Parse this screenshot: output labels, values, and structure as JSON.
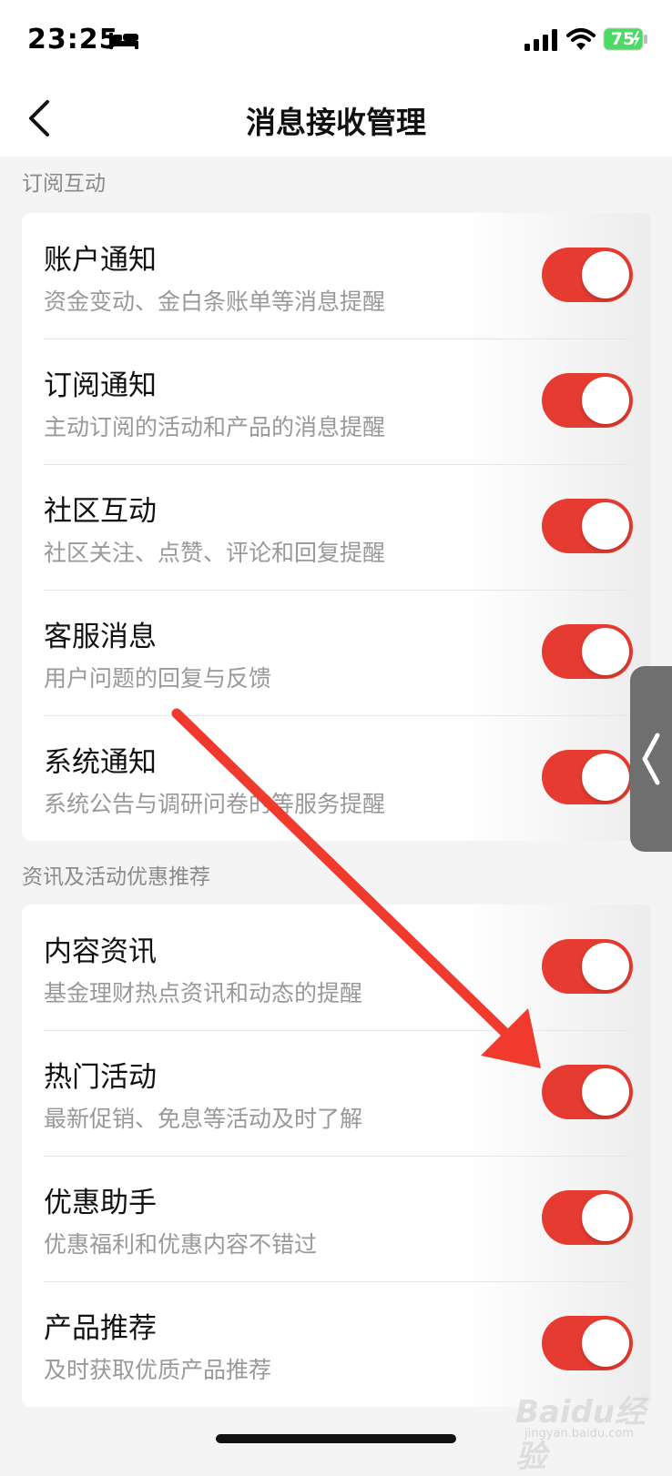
{
  "status_bar": {
    "time": "23:25",
    "battery_level": "75",
    "icons": [
      "bed-icon",
      "signal-icon",
      "wifi-icon",
      "battery-charging-icon"
    ]
  },
  "header": {
    "title": "消息接收管理",
    "back_icon": "chevron-left-icon"
  },
  "sections": [
    {
      "title": "订阅互动",
      "items": [
        {
          "title": "账户通知",
          "subtitle": "资金变动、金白条账单等消息提醒",
          "enabled": true
        },
        {
          "title": "订阅通知",
          "subtitle": "主动订阅的活动和产品的消息提醒",
          "enabled": true
        },
        {
          "title": "社区互动",
          "subtitle": "社区关注、点赞、评论和回复提醒",
          "enabled": true
        },
        {
          "title": "客服消息",
          "subtitle": "用户问题的回复与反馈",
          "enabled": true
        },
        {
          "title": "系统通知",
          "subtitle": "系统公告与调研问卷的等服务提醒",
          "enabled": true
        }
      ]
    },
    {
      "title": "资讯及活动优惠推荐",
      "items": [
        {
          "title": "内容资讯",
          "subtitle": "基金理财热点资讯和动态的提醒",
          "enabled": true
        },
        {
          "title": "热门活动",
          "subtitle": "最新促销、免息等活动及时了解",
          "enabled": true
        },
        {
          "title": "优惠助手",
          "subtitle": "优惠福利和优惠内容不错过",
          "enabled": true
        },
        {
          "title": "产品推荐",
          "subtitle": "及时获取优质产品推荐",
          "enabled": true
        }
      ]
    }
  ],
  "colors": {
    "toggle_on": "#e63b30",
    "annotation_arrow": "#f03a2e"
  },
  "watermark": {
    "logo": "Baidu经验",
    "url": "jingyan.baidu.com"
  }
}
